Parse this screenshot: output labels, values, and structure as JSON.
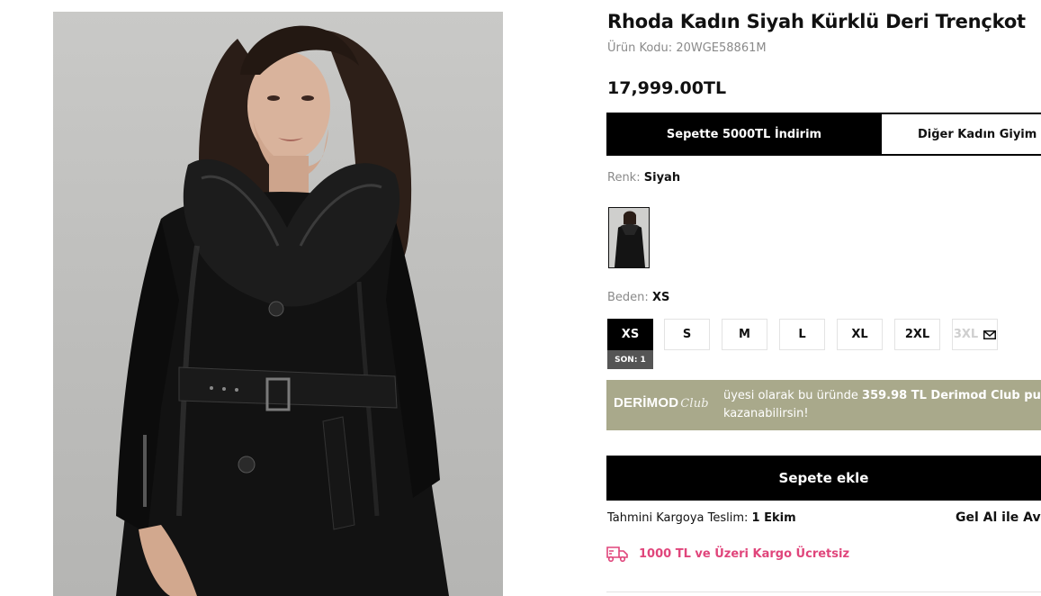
{
  "product": {
    "title": "Rhoda Kadın Siyah Kürklü Deri Trençkot",
    "code_label": "Ürün Kodu:",
    "code_value": "20WGE58861M",
    "price": "17,999.00TL",
    "image_alt": "Rhoda Kadın Siyah Kürklü Deri Trençkot"
  },
  "promo_tabs": [
    {
      "label": "Sepette 5000TL İndirim",
      "active": true
    },
    {
      "label": "Diğer Kadın Giyim",
      "active": false
    }
  ],
  "color": {
    "label": "Renk:",
    "value": "Siyah"
  },
  "size": {
    "label": "Beden:",
    "selected": "XS",
    "options": [
      {
        "label": "XS",
        "state": "selected",
        "badge": "SON: 1"
      },
      {
        "label": "S",
        "state": "available"
      },
      {
        "label": "M",
        "state": "available"
      },
      {
        "label": "L",
        "state": "available"
      },
      {
        "label": "XL",
        "state": "available"
      },
      {
        "label": "2XL",
        "state": "available"
      },
      {
        "label": "3XL",
        "state": "out-of-stock",
        "icon": "mail-icon"
      }
    ]
  },
  "club": {
    "logo_text": "DERİMOD",
    "logo_script": "Club",
    "text_before": "üyesi olarak bu üründe ",
    "points_value": "359.98 TL",
    "text_brand": " Derimod Club puanı",
    "text_after": "kazanabilirsin!",
    "background_color": "#a9a98b"
  },
  "cart": {
    "add_label": "Sepete ekle"
  },
  "delivery": {
    "label": "Tahmini Kargoya Teslim:",
    "date": "1 Ekim",
    "pickup_label": "Gel Al ile Av"
  },
  "shipping": {
    "icon": "truck-icon",
    "text": "1000 TL ve Üzeri Kargo Ücretsiz",
    "color": "#e0457b"
  }
}
